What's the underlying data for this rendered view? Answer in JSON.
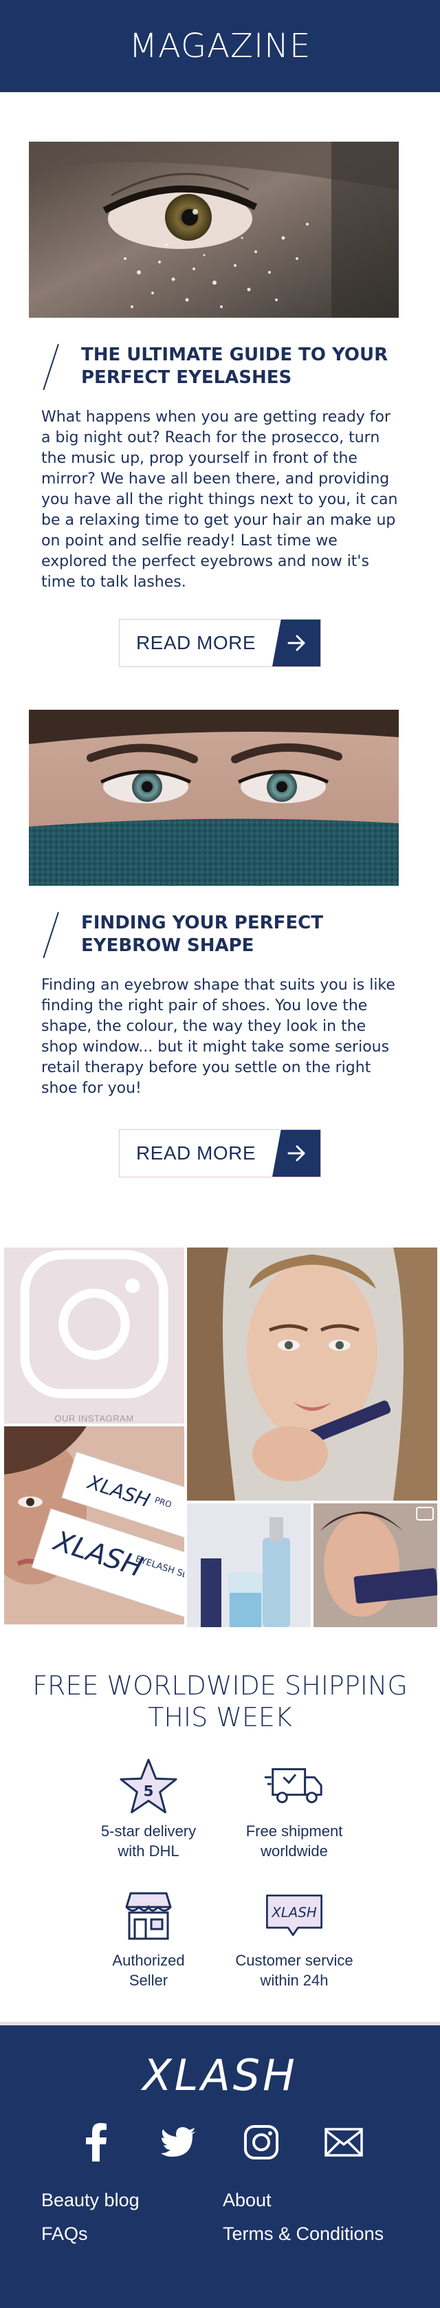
{
  "header": {
    "title": "MAGAZINE"
  },
  "articles": [
    {
      "title": "THE ULTIMATE GUIDE TO YOUR PERFECT EYELASHES",
      "body": "What happens when you are getting ready for a big night out? Reach for the prosecco, turn the music up, prop yourself in front of the mirror? We have all been there, and providing you have all the right things next to you, it can be a relaxing time to get your hair an make up on point and selfie ready! Last time we explored the perfect eyebrows and now it's time to talk lashes.",
      "button": "READ MORE"
    },
    {
      "title": "FINDING YOUR PERFECT EYEBROW SHAPE",
      "body": "Finding an eyebrow shape that suits you is like finding the right pair of shoes. You love the shape, the colour, the way they look in the shop window... but it might take some serious retail therapy before you settle on the right shoe for you!",
      "button": "READ MORE"
    }
  ],
  "instagram": {
    "label": "OUR INSTAGRAM",
    "box_brand": "XLASH",
    "box_sub": "PRO",
    "box_line": "EYELASH SERUM"
  },
  "shipping": {
    "title_line1": "FREE WORLDWIDE SHIPPING",
    "title_line2": "THIS WEEK",
    "star_number": "5",
    "features": [
      {
        "icon": "star-icon",
        "line1": "5-star delivery",
        "line2": "with DHL"
      },
      {
        "icon": "truck-icon",
        "line1": "Free shipment",
        "line2": "worldwide"
      },
      {
        "icon": "store-icon",
        "line1": "Authorized",
        "line2": "Seller"
      },
      {
        "icon": "chat-bubble-icon",
        "line1": "Customer service",
        "line2": "within 24h"
      }
    ],
    "bubble_text": "XLASH"
  },
  "footer": {
    "logo": "XLASH",
    "social": [
      "facebook-icon",
      "twitter-icon",
      "instagram-icon",
      "mail-icon"
    ],
    "links": [
      "Beauty blog",
      "About",
      "FAQs",
      "Terms & Conditions"
    ]
  },
  "colors": {
    "navy": "#1d3466",
    "pink_light": "#eadfe3",
    "pink_border": "#e6c7ce"
  }
}
